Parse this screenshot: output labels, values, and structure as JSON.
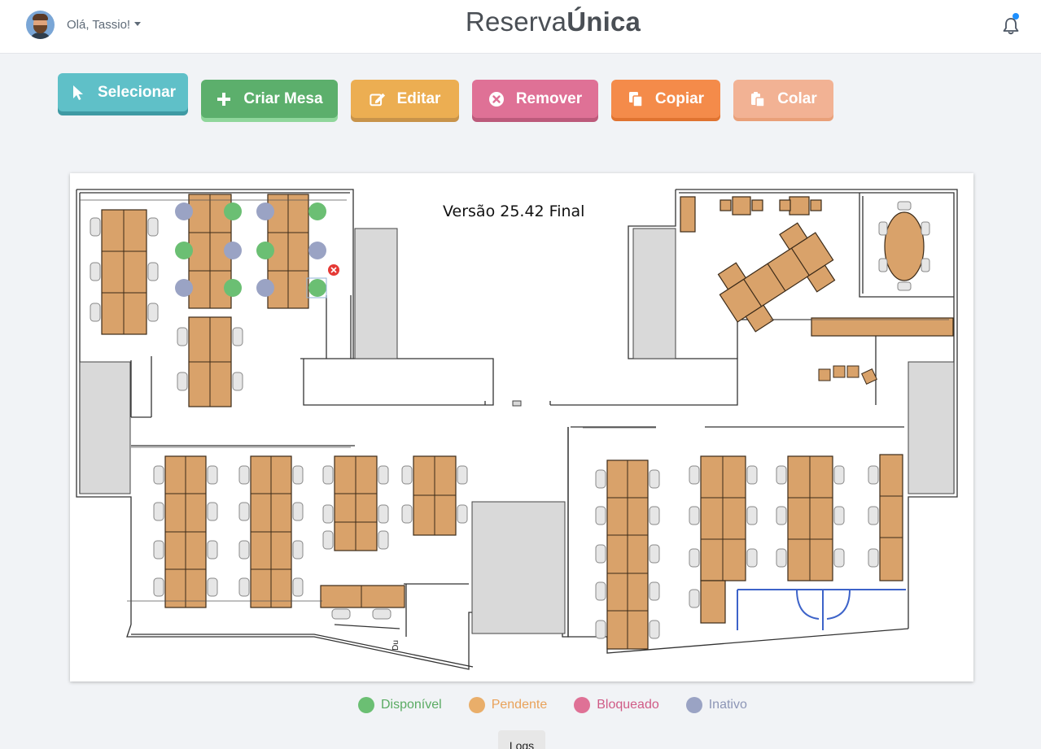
{
  "header": {
    "greeting": "Olá, Tassio!",
    "brand_light": "Reserva",
    "brand_bold": "Única",
    "notification_unread": true
  },
  "toolbar": {
    "select_label": "Selecionar",
    "create_label": "Criar Mesa",
    "edit_label": "Editar",
    "remove_label": "Remover",
    "copy_label": "Copiar",
    "paste_label": "Colar"
  },
  "floor_plan": {
    "version_label": "Versão 25.42 Final",
    "door_label": "Du"
  },
  "legend": [
    {
      "label": "Disponível",
      "color": "#6bbf73",
      "text_color": "#5aab63"
    },
    {
      "label": "Pendente",
      "color": "#e9ae6a",
      "text_color": "#e9a25a"
    },
    {
      "label": "Bloqueado",
      "color": "#df7196",
      "text_color": "#d05b86"
    },
    {
      "label": "Inativo",
      "color": "#9aa3c4",
      "text_color": "#8d96b6"
    }
  ],
  "footer": {
    "logs_label": "Logs"
  },
  "colors": {
    "desk": "#d9a26a",
    "seat_available": "#6bbf73",
    "seat_inactive": "#9aa3c4"
  }
}
